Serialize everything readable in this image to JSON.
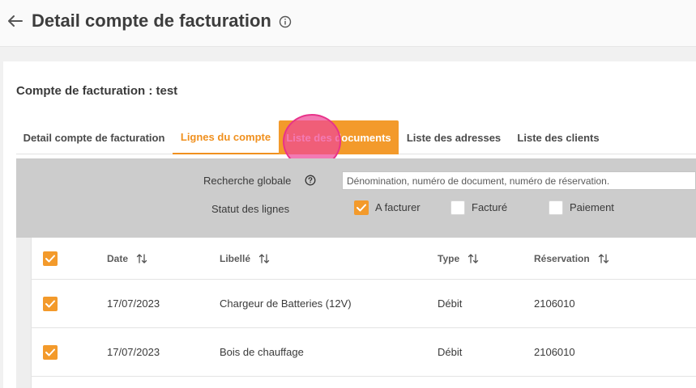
{
  "header": {
    "title": "Detail compte de facturation",
    "back_icon": "arrow-left-icon",
    "info_icon": "info-circle-icon"
  },
  "account": {
    "title": "Compte de facturation : test"
  },
  "tabs": [
    {
      "label": "Detail compte de facturation",
      "state": "default"
    },
    {
      "label": "Lignes du compte",
      "state": "active"
    },
    {
      "label": "Liste des documents",
      "state": "hover"
    },
    {
      "label": "Liste des adresses",
      "state": "default"
    },
    {
      "label": "Liste des clients",
      "state": "default"
    }
  ],
  "filters": {
    "search_label": "Recherche globale",
    "search_placeholder": "Dénomination, numéro de document, numéro de réservation.",
    "search_value": "",
    "status_label": "Statut des lignes",
    "status_options": [
      {
        "label": "A facturer",
        "checked": true
      },
      {
        "label": "Facturé",
        "checked": false
      },
      {
        "label": "Paiement",
        "checked": false
      }
    ]
  },
  "table": {
    "select_all_checked": true,
    "columns": [
      "Date",
      "Libellé",
      "Type",
      "Réservation"
    ],
    "rows": [
      {
        "checked": true,
        "date": "17/07/2023",
        "libelle": "Chargeur de Batteries (12V)",
        "type": "Débit",
        "reservation": "2106010"
      },
      {
        "checked": true,
        "date": "17/07/2023",
        "libelle": "Bois de chauffage",
        "type": "Débit",
        "reservation": "2106010"
      }
    ]
  },
  "colors": {
    "accent": "#f39a2b",
    "active_tab_text": "#f0901e",
    "filter_bg": "#cccccc",
    "click_marker": "#e8338a"
  }
}
